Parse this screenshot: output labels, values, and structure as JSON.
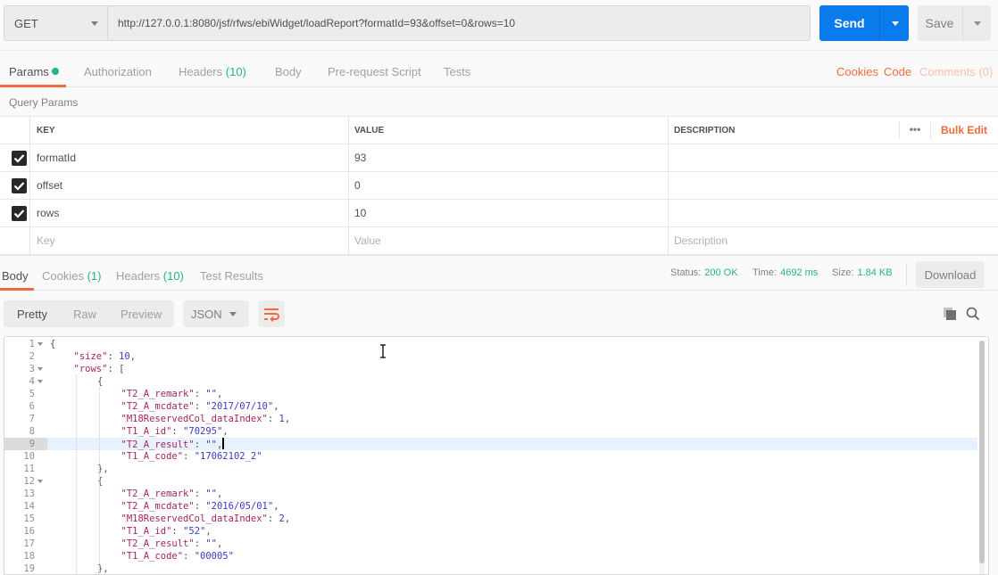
{
  "request": {
    "method": "GET",
    "url": "http://127.0.0.1:8080/jsf/rfws/ebiWidget/loadReport?formatId=93&offset=0&rows=10",
    "send_label": "Send",
    "save_label": "Save"
  },
  "request_tabs": [
    {
      "label": "Params",
      "active": true,
      "has_dot": true
    },
    {
      "label": "Authorization"
    },
    {
      "label": "Headers",
      "count": "(10)"
    },
    {
      "label": "Body"
    },
    {
      "label": "Pre-request Script"
    },
    {
      "label": "Tests"
    }
  ],
  "request_links": {
    "cookies": "Cookies",
    "code": "Code",
    "comments": "Comments (0)"
  },
  "query_params": {
    "title": "Query Params",
    "headers": {
      "key": "KEY",
      "value": "VALUE",
      "description": "DESCRIPTION"
    },
    "more_label": "•••",
    "bulk_edit": "Bulk Edit",
    "rows": [
      {
        "checked": true,
        "key": "formatId",
        "value": "93",
        "description": ""
      },
      {
        "checked": true,
        "key": "offset",
        "value": "0",
        "description": ""
      },
      {
        "checked": true,
        "key": "rows",
        "value": "10",
        "description": ""
      }
    ],
    "placeholders": {
      "key": "Key",
      "value": "Value",
      "description": "Description"
    }
  },
  "response_tabs": [
    {
      "label": "Body",
      "active": true
    },
    {
      "label": "Cookies",
      "count": "(1)"
    },
    {
      "label": "Headers",
      "count": "(10)"
    },
    {
      "label": "Test Results"
    }
  ],
  "response_status": {
    "status_label": "Status:",
    "status": "200 OK",
    "time_label": "Time:",
    "time": "4692 ms",
    "size_label": "Size:",
    "size": "1.84 KB",
    "download": "Download"
  },
  "view_modes": [
    "Pretty",
    "Raw",
    "Preview"
  ],
  "active_view": "Pretty",
  "format": "JSON",
  "editor": {
    "highlighted_line": 9,
    "lines": [
      {
        "n": "1",
        "fold": true,
        "indent": 0,
        "tokens": [
          [
            "p",
            "{"
          ]
        ]
      },
      {
        "n": "2",
        "indent": 1,
        "tokens": [
          [
            "k",
            "\"size\""
          ],
          [
            "p",
            ": "
          ],
          [
            "n",
            "10"
          ],
          [
            "p",
            ","
          ]
        ]
      },
      {
        "n": "3",
        "fold": true,
        "indent": 1,
        "tokens": [
          [
            "k",
            "\"rows\""
          ],
          [
            "p",
            ": ["
          ]
        ]
      },
      {
        "n": "4",
        "fold": true,
        "indent": 2,
        "tokens": [
          [
            "p",
            "{"
          ]
        ]
      },
      {
        "n": "5",
        "indent": 3,
        "tokens": [
          [
            "k",
            "\"T2_A_remark\""
          ],
          [
            "p",
            ": "
          ],
          [
            "s",
            "\"\""
          ],
          [
            "p",
            ","
          ]
        ]
      },
      {
        "n": "6",
        "indent": 3,
        "tokens": [
          [
            "k",
            "\"T2_A_mcdate\""
          ],
          [
            "p",
            ": "
          ],
          [
            "s",
            "\"2017/07/10\""
          ],
          [
            "p",
            ","
          ]
        ]
      },
      {
        "n": "7",
        "indent": 3,
        "tokens": [
          [
            "k",
            "\"M18ReservedCol_dataIndex\""
          ],
          [
            "p",
            ": "
          ],
          [
            "n",
            "1"
          ],
          [
            "p",
            ","
          ]
        ]
      },
      {
        "n": "8",
        "indent": 3,
        "tokens": [
          [
            "k",
            "\"T1_A_id\""
          ],
          [
            "p",
            ": "
          ],
          [
            "s",
            "\"70295\""
          ],
          [
            "p",
            ","
          ]
        ]
      },
      {
        "n": "9",
        "indent": 3,
        "tokens": [
          [
            "k",
            "\"T2_A_result\""
          ],
          [
            "p",
            ": "
          ],
          [
            "s",
            "\"\""
          ],
          [
            "p",
            ","
          ]
        ],
        "cursor": true
      },
      {
        "n": "10",
        "indent": 3,
        "tokens": [
          [
            "k",
            "\"T1_A_code\""
          ],
          [
            "p",
            ": "
          ],
          [
            "s",
            "\"17062102_2\""
          ]
        ]
      },
      {
        "n": "11",
        "indent": 2,
        "tokens": [
          [
            "p",
            "},"
          ]
        ]
      },
      {
        "n": "12",
        "fold": true,
        "indent": 2,
        "tokens": [
          [
            "p",
            "{"
          ]
        ]
      },
      {
        "n": "13",
        "indent": 3,
        "tokens": [
          [
            "k",
            "\"T2_A_remark\""
          ],
          [
            "p",
            ": "
          ],
          [
            "s",
            "\"\""
          ],
          [
            "p",
            ","
          ]
        ]
      },
      {
        "n": "14",
        "indent": 3,
        "tokens": [
          [
            "k",
            "\"T2_A_mcdate\""
          ],
          [
            "p",
            ": "
          ],
          [
            "s",
            "\"2016/05/01\""
          ],
          [
            "p",
            ","
          ]
        ]
      },
      {
        "n": "15",
        "indent": 3,
        "tokens": [
          [
            "k",
            "\"M18ReservedCol_dataIndex\""
          ],
          [
            "p",
            ": "
          ],
          [
            "n",
            "2"
          ],
          [
            "p",
            ","
          ]
        ]
      },
      {
        "n": "16",
        "indent": 3,
        "tokens": [
          [
            "k",
            "\"T1_A_id\""
          ],
          [
            "p",
            ": "
          ],
          [
            "s",
            "\"52\""
          ],
          [
            "p",
            ","
          ]
        ]
      },
      {
        "n": "17",
        "indent": 3,
        "tokens": [
          [
            "k",
            "\"T2_A_result\""
          ],
          [
            "p",
            ": "
          ],
          [
            "s",
            "\"\""
          ],
          [
            "p",
            ","
          ]
        ]
      },
      {
        "n": "18",
        "indent": 3,
        "tokens": [
          [
            "k",
            "\"T1_A_code\""
          ],
          [
            "p",
            ": "
          ],
          [
            "s",
            "\"00005\""
          ]
        ]
      },
      {
        "n": "19",
        "indent": 2,
        "tokens": [
          [
            "p",
            "},"
          ]
        ]
      }
    ]
  },
  "colors": {
    "accent": "#f26b3a",
    "primary": "#097bed",
    "success": "#26b47f"
  }
}
